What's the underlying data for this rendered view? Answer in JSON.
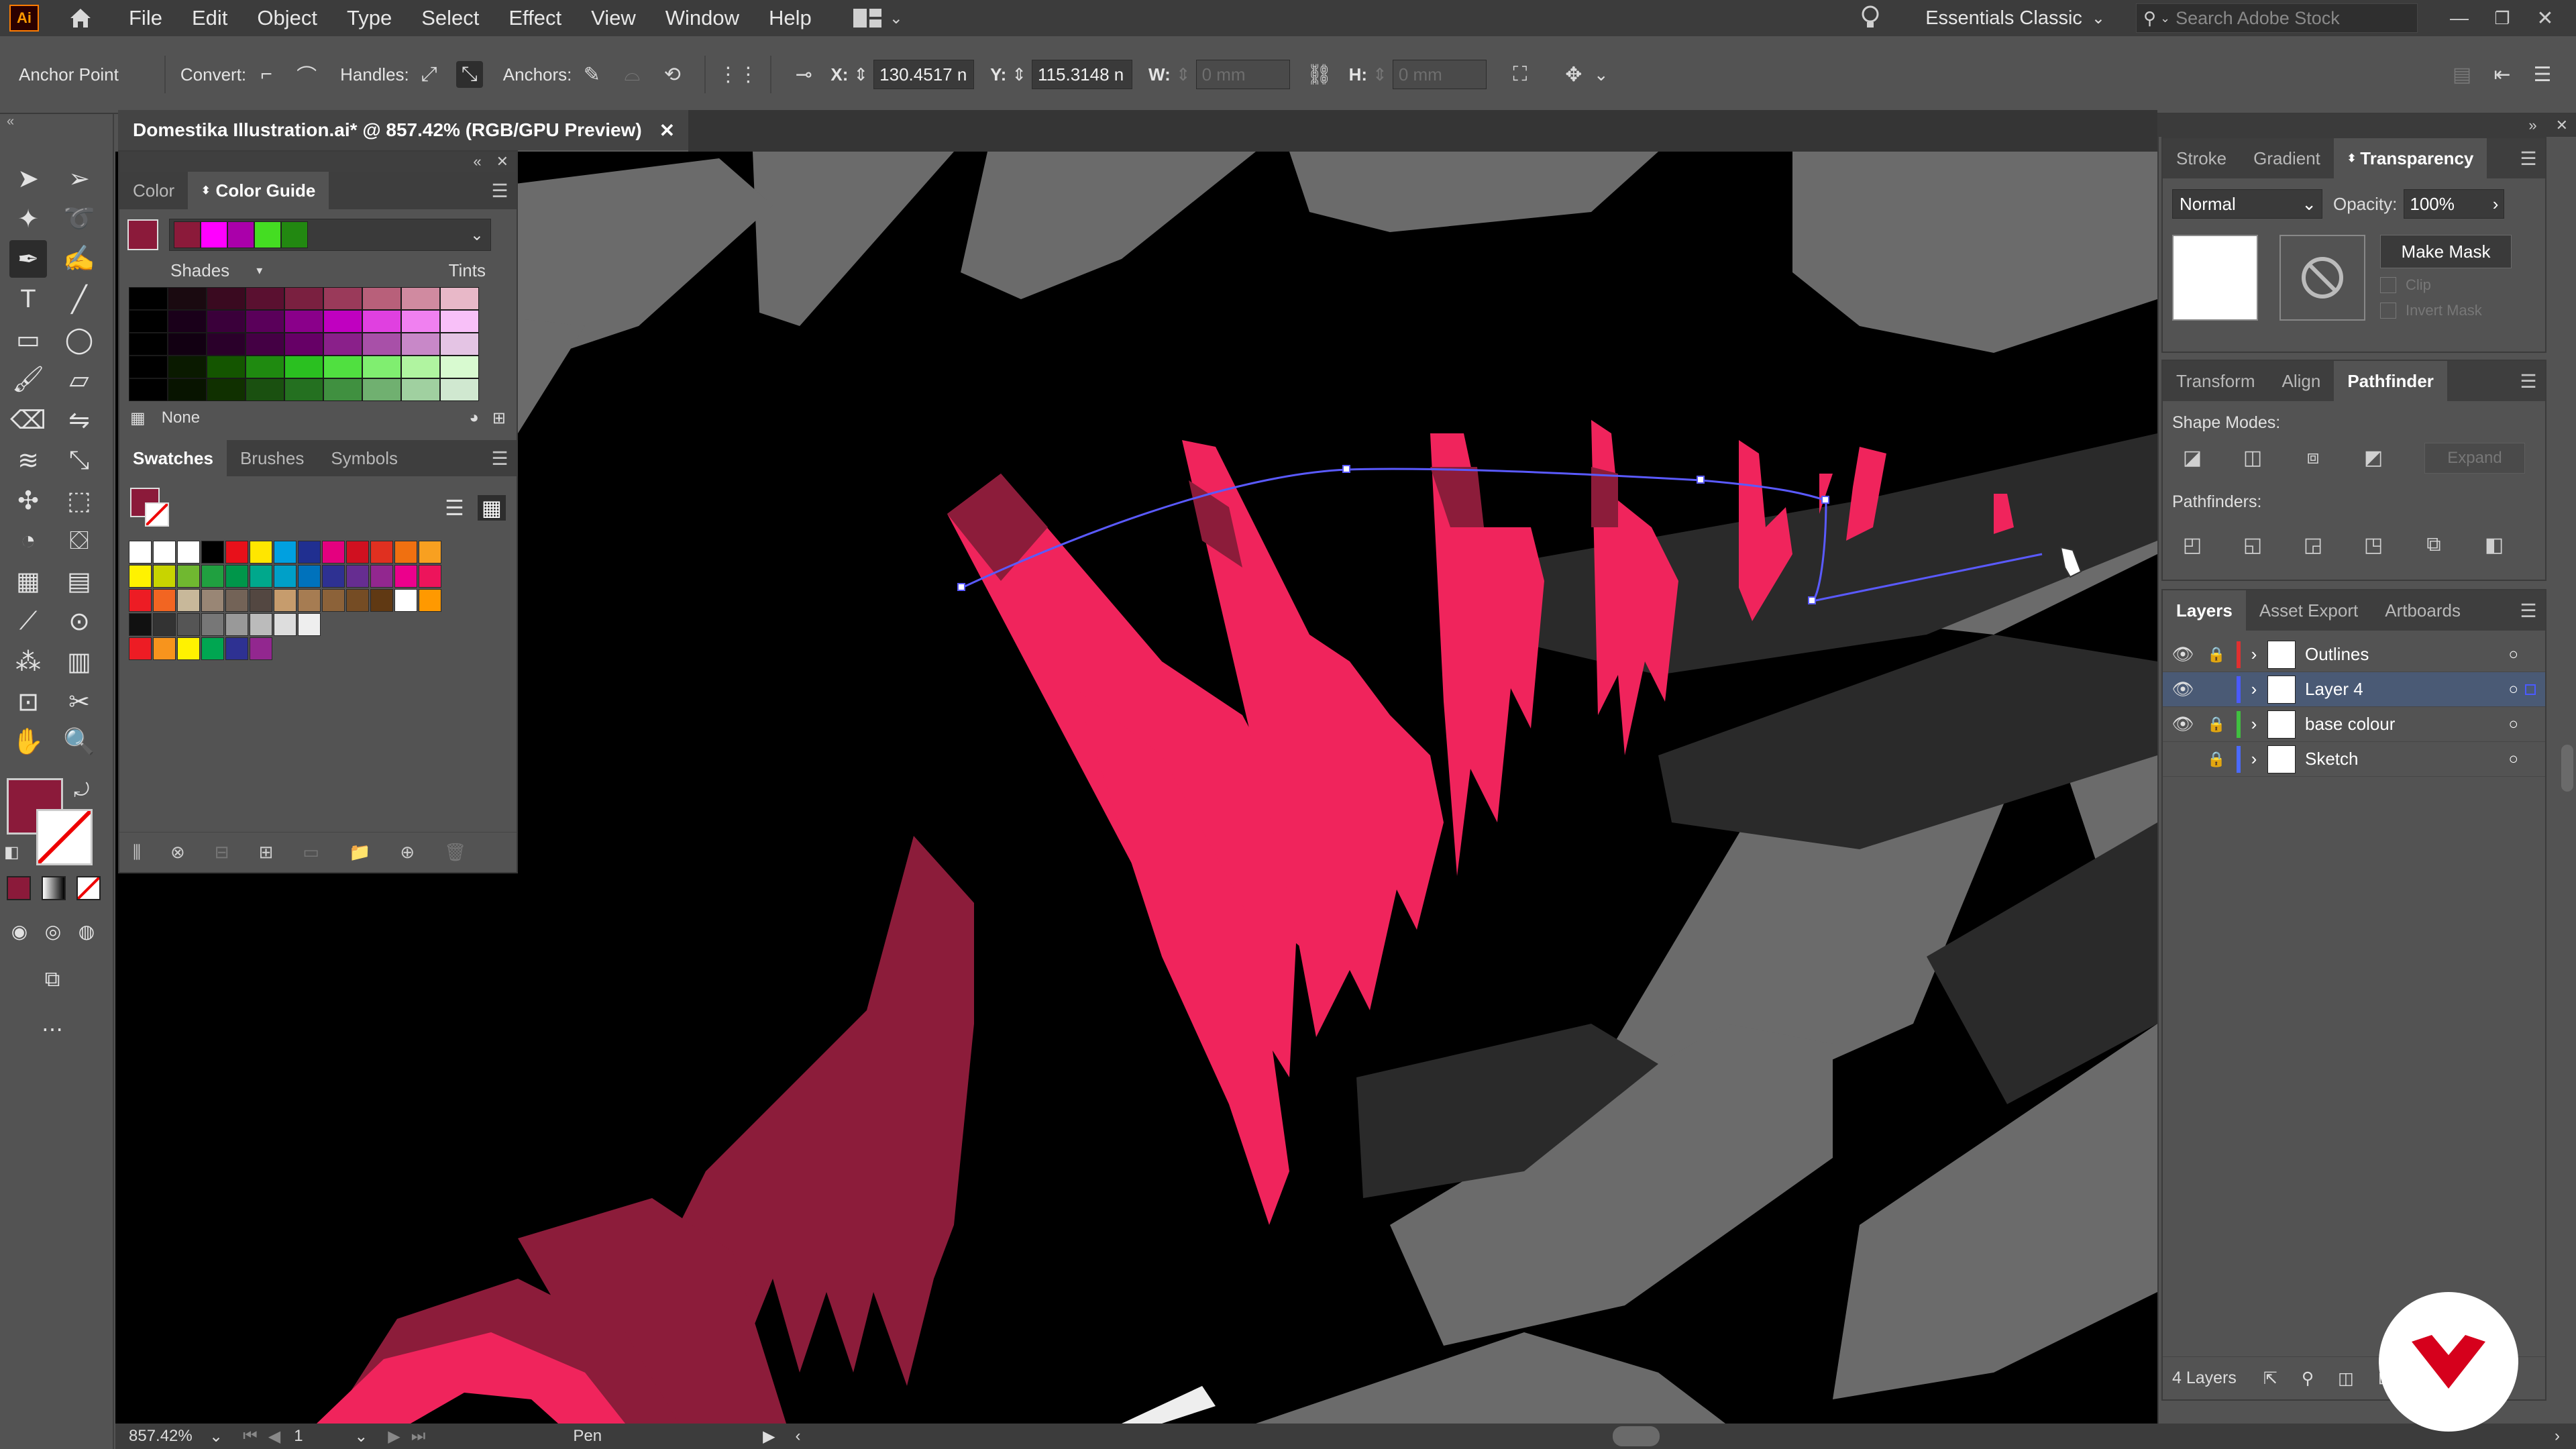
{
  "app": {
    "logo_text": "Ai"
  },
  "menu": [
    "File",
    "Edit",
    "Object",
    "Type",
    "Select",
    "Effect",
    "View",
    "Window",
    "Help"
  ],
  "workspace": {
    "name": "Essentials Classic"
  },
  "search": {
    "placeholder": "Search Adobe Stock"
  },
  "control": {
    "tool_label": "Anchor Point",
    "convert_label": "Convert:",
    "handles_label": "Handles:",
    "anchors_label": "Anchors:",
    "x_label": "X:",
    "x_value": "130.4517 n",
    "y_label": "Y:",
    "y_value": "115.3148 n",
    "w_label": "W:",
    "w_value": "0 mm",
    "h_label": "H:",
    "h_value": "0 mm"
  },
  "document": {
    "tab_title": "Domestika Illustration.ai* @ 857.42% (RGB/GPU Preview)"
  },
  "color_panel": {
    "tabs": [
      "Color",
      "Color Guide"
    ],
    "active_tab": "Color Guide",
    "shades_label": "Shades",
    "tints_label": "Tints",
    "none_label": "None",
    "harmony_colors": [
      "#8b1a3a",
      "#ff00ff",
      "#aa00aa",
      "#44dd22",
      "#228811"
    ],
    "grid_colors": [
      [
        "#000000",
        "#1a0a10",
        "#3a0a20",
        "#5a1030",
        "#7a2040",
        "#9a3a5a",
        "#b8607a",
        "#d08aa0",
        "#e8b8c8"
      ],
      [
        "#000000",
        "#1a001a",
        "#3a003a",
        "#5a005a",
        "#8a008a",
        "#c000c0",
        "#e040e0",
        "#f080f0",
        "#f8c0f8"
      ],
      [
        "#000000",
        "#120012",
        "#2a002a",
        "#440044",
        "#660066",
        "#8a208a",
        "#a850a8",
        "#c888c8",
        "#e4c4e4"
      ],
      [
        "#000000",
        "#0a1a00",
        "#145500",
        "#1f8a10",
        "#2ac020",
        "#50e040",
        "#80ee70",
        "#b0f4a0",
        "#d8fad0"
      ],
      [
        "#000000",
        "#081400",
        "#103000",
        "#1a5010",
        "#247020",
        "#409040",
        "#70b070",
        "#a0d0a0",
        "#d0e8d0"
      ]
    ]
  },
  "swatches_panel": {
    "tabs": [
      "Swatches",
      "Brushes",
      "Symbols"
    ],
    "active_tab": "Swatches",
    "rows": [
      [
        "#ffffff",
        "#ffffff",
        "#ffffff",
        "#000000",
        "#e8101a",
        "#ffe600",
        "#00a0e0",
        "#202f90",
        "#e4007f",
        "#d01020",
        "#e03020",
        "#f07010",
        "#f8a020"
      ],
      [
        "#fff200",
        "#c8d400",
        "#70b830",
        "#20a040",
        "#00964a",
        "#00a88c",
        "#00a0c8",
        "#0072bc",
        "#2e3192",
        "#662d91",
        "#92278f",
        "#ec008c",
        "#ed145b"
      ],
      [
        "#ed1c24",
        "#f26522",
        "#c8b89a",
        "#998675",
        "#736357",
        "#534741",
        "#c69c6d",
        "#a67c52",
        "#8c6239",
        "#754c24",
        "#603913",
        "#ffffff",
        "#ff9900"
      ],
      [
        "#111111",
        "#333333",
        "#555555",
        "#777777",
        "#999999",
        "#bbbbbb",
        "#dddddd",
        "#eeeeee"
      ],
      [
        "#ed1c24",
        "#f7941d",
        "#fff200",
        "#00a651",
        "#2e3192",
        "#92278f"
      ]
    ]
  },
  "fill_color": "#8b1a3a",
  "right_panels": {
    "top_tabs": [
      "Stroke",
      "Gradient",
      "Transparency"
    ],
    "top_active": "Transparency",
    "blend_mode": "Normal",
    "opacity_label": "Opacity:",
    "opacity_value": "100%",
    "make_mask": "Make Mask",
    "clip_label": "Clip",
    "invert_label": "Invert Mask",
    "mid_tabs": [
      "Transform",
      "Align",
      "Pathfinder"
    ],
    "mid_active": "Pathfinder",
    "shape_modes_label": "Shape Modes:",
    "pathfinders_label": "Pathfinders:",
    "expand_label": "Expand",
    "layer_tabs": [
      "Layers",
      "Asset Export",
      "Artboards"
    ],
    "layer_active": "Layers",
    "layers": [
      {
        "name": "Outlines",
        "color": "#e03030"
      },
      {
        "name": "Layer 4",
        "color": "#4a5aff"
      },
      {
        "name": "base colour",
        "color": "#40c040"
      },
      {
        "name": "Sketch",
        "color": "#4a6aff"
      }
    ],
    "layers_count": "4 Layers"
  },
  "status": {
    "zoom": "857.42%",
    "artboard": "1",
    "tool": "Pen"
  },
  "colors": {
    "pink": "#f0245c",
    "maroon": "#8c1c3a",
    "dark_gray": "#2a2a2a",
    "mid_gray": "#6b6b6b",
    "path_blue": "#5a5aff"
  }
}
